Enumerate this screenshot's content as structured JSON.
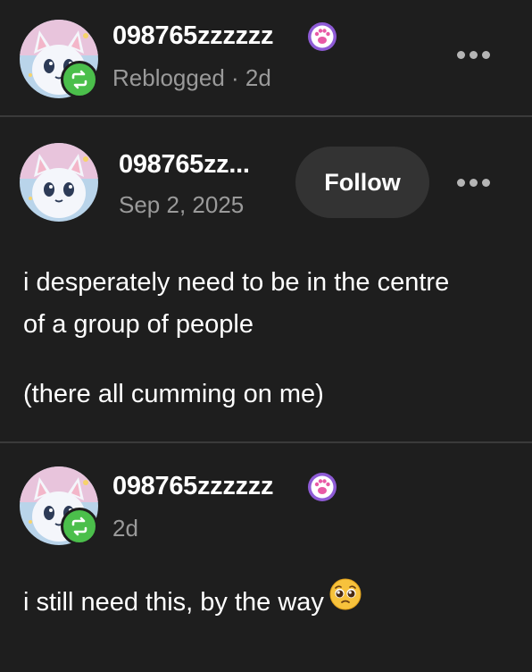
{
  "reblog_header": {
    "username": "098765zzzzzz",
    "meta": "Reblogged · 2d",
    "avatar": "anime-cat-avatar",
    "badge_icon": "reblog-icon",
    "verified_icon": "paw-icon"
  },
  "original_post": {
    "username": "098765zz...",
    "date": "Sep 2, 2025",
    "follow_label": "Follow",
    "avatar": "anime-cat-avatar",
    "paragraphs": [
      "i desperately need to be in the centre",
      "of a group of people",
      "(there all cumming on me)"
    ]
  },
  "reblog_comment": {
    "username": "098765zzzzzz",
    "meta": "2d",
    "avatar": "anime-cat-avatar",
    "badge_icon": "reblog-icon",
    "verified_icon": "paw-icon",
    "text": "i still need this, by the way",
    "emoji": "pleading-face-icon"
  },
  "colors": {
    "background": "#1e1e1e",
    "divider": "#3a3a3a",
    "muted_text": "#9a9a9a",
    "reblog_badge": "#4bbf4b",
    "paw_badge": "#8e5bd6",
    "follow_button": "#333333"
  }
}
